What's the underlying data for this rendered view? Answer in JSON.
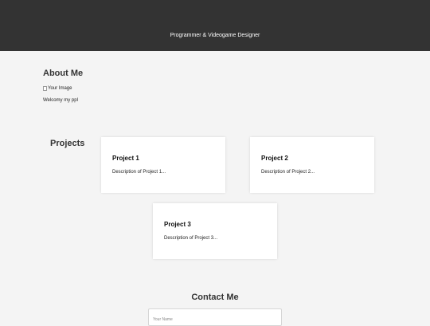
{
  "header": {
    "tagline": "Programmer & Videogame Designer"
  },
  "about": {
    "title": "About Me",
    "image_alt": "Your Image",
    "text": "Welcomy my ppl"
  },
  "projects": {
    "title": "Projects",
    "items": [
      {
        "title": "Project 1",
        "description": "Description of Project 1..."
      },
      {
        "title": "Project 2",
        "description": "Description of Project 2..."
      },
      {
        "title": "Project 3",
        "description": "Description of Project 3..."
      }
    ]
  },
  "contact": {
    "title": "Contact Me",
    "name_placeholder": "Your Name"
  },
  "colors": {
    "header_bg": "#333333",
    "page_bg": "#f4f4f4",
    "card_bg": "#ffffff"
  },
  "icons": {
    "broken_image": "broken-image-icon"
  }
}
